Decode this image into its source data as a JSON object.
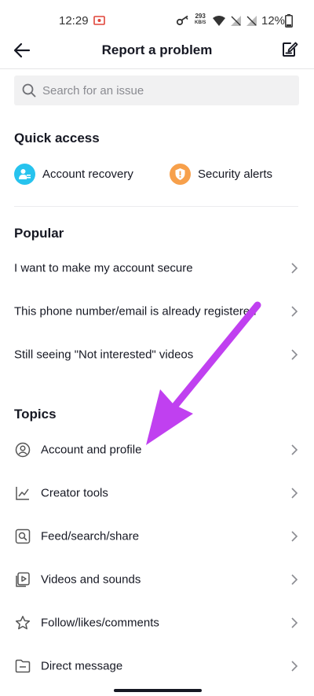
{
  "status_bar": {
    "time": "12:29",
    "net_speed_value": "293",
    "net_speed_unit": "KB/S",
    "battery_pct": "12%"
  },
  "header": {
    "title": "Report a problem"
  },
  "search": {
    "placeholder": "Search for an issue"
  },
  "quick_access": {
    "title": "Quick access",
    "items": [
      {
        "label": "Account recovery",
        "icon": "account-recovery-icon",
        "color": "#27c3ee"
      },
      {
        "label": "Security alerts",
        "icon": "shield-icon",
        "color": "#f7a04b"
      }
    ]
  },
  "popular": {
    "title": "Popular",
    "items": [
      {
        "label": "I want to make my account secure"
      },
      {
        "label": "This phone number/email is already registered"
      },
      {
        "label": "Still seeing \"Not interested\" videos"
      }
    ]
  },
  "topics": {
    "title": "Topics",
    "items": [
      {
        "label": "Account and profile",
        "icon": "user-circle-icon"
      },
      {
        "label": "Creator tools",
        "icon": "line-chart-icon"
      },
      {
        "label": "Feed/search/share",
        "icon": "search-square-icon"
      },
      {
        "label": "Videos and sounds",
        "icon": "video-icon"
      },
      {
        "label": "Follow/likes/comments",
        "icon": "star-icon"
      },
      {
        "label": "Direct message",
        "icon": "message-folder-icon"
      }
    ]
  },
  "colors": {
    "annotation_arrow": "#c040f0",
    "text_primary": "#161823",
    "text_secondary": "#8a8b91"
  }
}
